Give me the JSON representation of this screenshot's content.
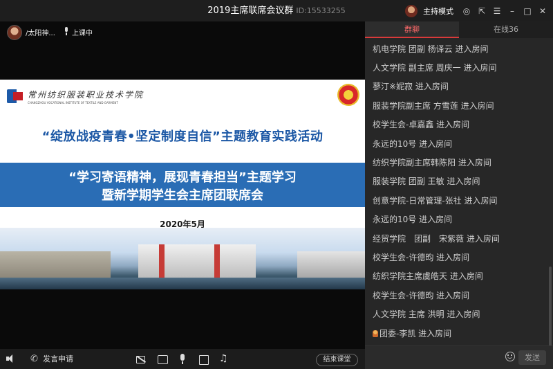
{
  "window": {
    "title": "2019主席联席会议群",
    "room_id": "ID:15533255",
    "mode_label": "主持模式"
  },
  "video": {
    "host_name": "/太阳神...",
    "lesson_status": "上课中"
  },
  "slide": {
    "school_name": "常州纺织服装职业技术学院",
    "school_name_en": "CHANGZHOU VOCATIONAL INSTITUTE OF TEXTILE AND GARMENT",
    "title": "“绽放战疫青春•坚定制度自信”主题教育实践活动",
    "subtitle_line1": "“学习寄语精神，展现青春担当”主题学习",
    "subtitle_line2": "暨新学期学生会主席团联席会",
    "date": "2020年5月"
  },
  "toolbar": {
    "speak_request_label": "发言申请",
    "end_class_label": "结束课堂"
  },
  "panel": {
    "tab_chat": "群聊",
    "tab_online": "在线36",
    "messages": [
      {
        "text": "机电学院 团副 杨译云 进入房间"
      },
      {
        "text": "人文学院 副主席 周庆一 进入房间"
      },
      {
        "text": "蓼汀※妮寂 进入房间"
      },
      {
        "text": "服装学院副主席 方雪莲 进入房间"
      },
      {
        "text": "校学生会-卓嘉鑫 进入房间"
      },
      {
        "text": "永远的10号 进入房间"
      },
      {
        "text": "纺织学院副主席韩陈阳 进入房间"
      },
      {
        "text": "服装学院 团副 王敏 进入房间"
      },
      {
        "text": "创意学院-日常管理-张社 进入房间"
      },
      {
        "text": "永远的10号 进入房间"
      },
      {
        "text": "经贸学院　团副　宋紫薇 进入房间"
      },
      {
        "text": "校学生会-许德昀 进入房间"
      },
      {
        "text": "纺织学院主席虞皓天 进入房间"
      },
      {
        "text": "校学生会-许德昀 进入房间"
      },
      {
        "text": "人文学院 主席 洪明 进入房间"
      },
      {
        "text": "团委-李凯 进入房间"
      }
    ],
    "send_label": "发送",
    "input_value": ""
  },
  "colors": {
    "accent_red": "#d93a3a",
    "slide_blue": "#2a6db5"
  }
}
